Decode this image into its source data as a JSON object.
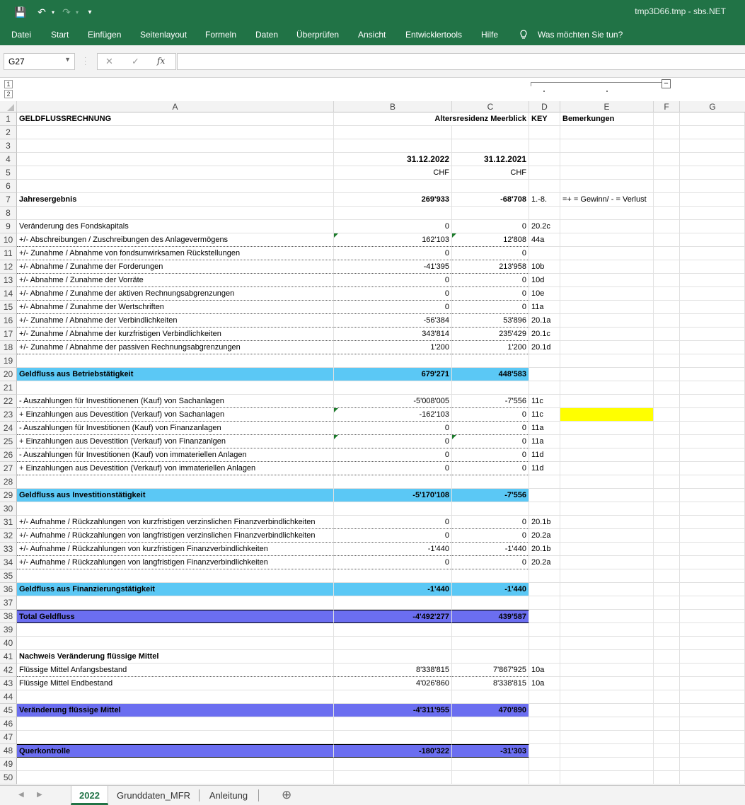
{
  "window": {
    "title": "tmp3D66.tmp  -  sbs.NET",
    "qa_save": "💾",
    "qa_undo": "↶",
    "qa_redo": "↷",
    "qa_more": "▾"
  },
  "ribbon": {
    "tabs": [
      "Datei",
      "Start",
      "Einfügen",
      "Seitenlayout",
      "Formeln",
      "Daten",
      "Überprüfen",
      "Ansicht",
      "Entwicklertools",
      "Hilfe"
    ],
    "tell_me": "Was möchten Sie tun?"
  },
  "formula_bar": {
    "name_box": "G27",
    "cancel": "✕",
    "enter": "✓",
    "fx": "fx",
    "value": ""
  },
  "outline": {
    "levels": [
      "1",
      "2"
    ],
    "collapse": "−"
  },
  "columns": [
    "A",
    "B",
    "C",
    "D",
    "E",
    "F",
    "G"
  ],
  "rows": [
    {
      "n": "1",
      "A": "GELDFLUSSRECHNUNG",
      "B": "Altersresidenz Meerblick",
      "C": "",
      "D": "KEY",
      "E": "Bemerkungen"
    },
    {
      "n": "2"
    },
    {
      "n": "3"
    },
    {
      "n": "4",
      "B": "31.12.2022",
      "C": "31.12.2021"
    },
    {
      "n": "5",
      "B": "CHF",
      "C": "CHF"
    },
    {
      "n": "6"
    },
    {
      "n": "7",
      "A": "Jahresergebnis",
      "B": "269'933",
      "C": "-68'708",
      "D": "1.-8.",
      "E": "=+ = Gewinn/ - = Verlust"
    },
    {
      "n": "8"
    },
    {
      "n": "9",
      "A": "Veränderung des Fondskapitals",
      "B": "0",
      "C": "0",
      "D": "20.2c"
    },
    {
      "n": "10",
      "A": "+/- Abschreibungen / Zuschreibungen des Anlagevermögens",
      "B": "162'103",
      "C": "12'808",
      "D": "44a"
    },
    {
      "n": "11",
      "A": "+/- Zunahme / Abnahme von fondsunwirksamen Rückstellungen",
      "B": "0",
      "C": "0",
      "D": ""
    },
    {
      "n": "12",
      "A": "+/- Abnahme / Zunahme der Forderungen",
      "B": "-41'395",
      "C": "213'958",
      "D": "10b"
    },
    {
      "n": "13",
      "A": "+/- Abnahme / Zunahme der Vorräte",
      "B": "0",
      "C": "0",
      "D": "10d"
    },
    {
      "n": "14",
      "A": "+/- Abnahme / Zunahme der aktiven Rechnungsabgrenzungen",
      "B": "0",
      "C": "0",
      "D": "10e"
    },
    {
      "n": "15",
      "A": "+/- Abnahme / Zunahme der Wertschriften",
      "B": "0",
      "C": "0",
      "D": "11a"
    },
    {
      "n": "16",
      "A": "+/- Zunahme / Abnahme der Verbindlichkeiten",
      "B": "-56'384",
      "C": "53'896",
      "D": "20.1a"
    },
    {
      "n": "17",
      "A": "+/- Zunahme / Abnahme der kurzfristigen Verbindlichkeiten",
      "B": "343'814",
      "C": "235'429",
      "D": "20.1c"
    },
    {
      "n": "18",
      "A": "+/- Zunahme / Abnahme der passiven Rechnungsabgrenzungen",
      "B": "1'200",
      "C": "1'200",
      "D": "20.1d"
    },
    {
      "n": "19"
    },
    {
      "n": "20",
      "A": "Geldfluss aus Betriebstätigkeit",
      "B": "679'271",
      "C": "448'583"
    },
    {
      "n": "21"
    },
    {
      "n": "22",
      "A": "- Auszahlungen für Investitionenen (Kauf) von Sachanlagen",
      "B": "-5'008'005",
      "C": "-7'556",
      "D": "11c"
    },
    {
      "n": "23",
      "A": "+ Einzahlungen aus Devestition (Verkauf) von Sachanlagen",
      "B": "-162'103",
      "C": "0",
      "D": "11c"
    },
    {
      "n": "24",
      "A": "- Auszahlungen für Investitionen (Kauf) von Finanzanlagen",
      "B": "0",
      "C": "0",
      "D": "11a"
    },
    {
      "n": "25",
      "A": "+ Einzahlungen aus Devestition (Verkauf) von Finanzanlgen",
      "B": "0",
      "C": "0",
      "D": "11a"
    },
    {
      "n": "26",
      "A": "- Auszahlungen für Investitionen (Kauf) von immateriellen Anlagen",
      "B": "0",
      "C": "0",
      "D": "11d"
    },
    {
      "n": "27",
      "A": "+ Einzahlungen aus Devestition (Verkauf) von immateriellen Anlagen",
      "B": "0",
      "C": "0",
      "D": "11d"
    },
    {
      "n": "28"
    },
    {
      "n": "29",
      "A": "Geldfluss aus Investitionstätigkeit",
      "B": "-5'170'108",
      "C": "-7'556"
    },
    {
      "n": "30"
    },
    {
      "n": "31",
      "A": "+/- Aufnahme / Rückzahlungen von kurzfristigen verzinslichen Finanzverbindlichkeiten",
      "B": "0",
      "C": "0",
      "D": "20.1b"
    },
    {
      "n": "32",
      "A": "+/- Aufnahme / Rückzahlungen von langfristigen verzinslichen Finanzverbindlichkeiten",
      "B": "0",
      "C": "0",
      "D": "20.2a"
    },
    {
      "n": "33",
      "A": "+/- Aufnahme / Rückzahlungen von kurzfristigen Finanzverbindlichkeiten",
      "B": "-1'440",
      "C": "-1'440",
      "D": "20.1b"
    },
    {
      "n": "34",
      "A": "+/- Aufnahme / Rückzahlungen von langfristigen Finanzverbindlichkeiten",
      "B": "0",
      "C": "0",
      "D": "20.2a"
    },
    {
      "n": "35"
    },
    {
      "n": "36",
      "A": "Geldfluss aus Finanzierungstätigkeit",
      "B": "-1'440",
      "C": "-1'440"
    },
    {
      "n": "37"
    },
    {
      "n": "38",
      "A": "Total Geldfluss",
      "B": "-4'492'277",
      "C": "439'587"
    },
    {
      "n": "39"
    },
    {
      "n": "40"
    },
    {
      "n": "41",
      "A": "Nachweis Veränderung flüssige Mittel"
    },
    {
      "n": "42",
      "A": "Flüssige Mittel Anfangsbestand",
      "B": "8'338'815",
      "C": "7'867'925",
      "D": "10a"
    },
    {
      "n": "43",
      "A": "Flüssige Mittel Endbestand",
      "B": "4'026'860",
      "C": "8'338'815",
      "D": "10a"
    },
    {
      "n": "44"
    },
    {
      "n": "45",
      "A": "Veränderung flüssige Mittel",
      "B": "-4'311'955",
      "C": "470'890"
    },
    {
      "n": "46"
    },
    {
      "n": "47"
    },
    {
      "n": "48",
      "A": "Querkontrolle",
      "B": "-180'322",
      "C": "-31'303"
    },
    {
      "n": "49"
    },
    {
      "n": "50"
    }
  ],
  "colors": {
    "accent": "#217346",
    "band_light": "#5bc8f5",
    "band_dark": "#6b6ef0",
    "highlight": "#ffff00"
  },
  "sheets": {
    "tabs": [
      "2022",
      "Grunddaten_MFR",
      "Anleitung"
    ],
    "active": "2022",
    "add": "⊕",
    "prev": "◀",
    "next": "▶"
  }
}
